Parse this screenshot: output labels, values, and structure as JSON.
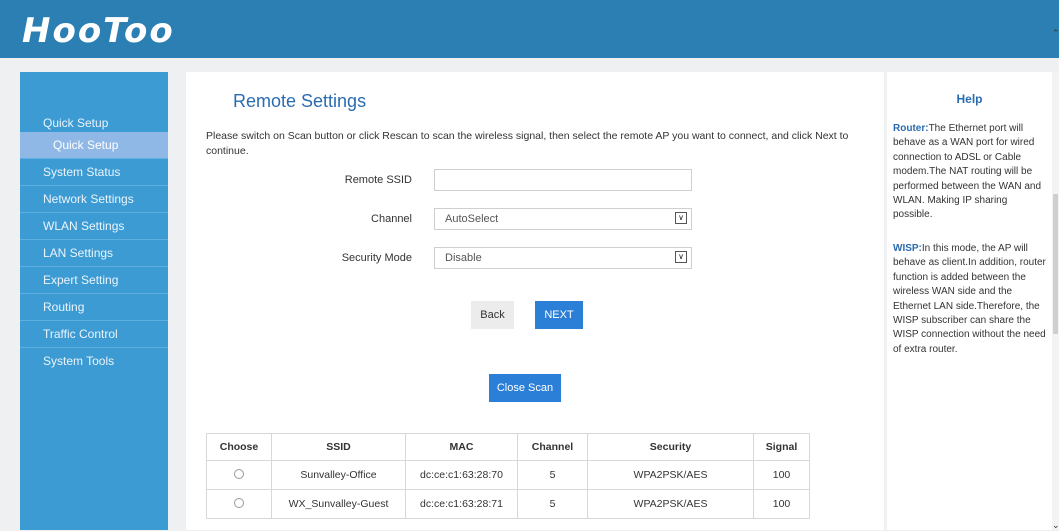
{
  "brand": {
    "logo_text": "HooToo"
  },
  "sidebar": {
    "items": [
      {
        "label": "Quick Setup"
      },
      {
        "label": "Quick Setup"
      },
      {
        "label": "System Status"
      },
      {
        "label": "Network Settings"
      },
      {
        "label": "WLAN Settings"
      },
      {
        "label": "LAN Settings"
      },
      {
        "label": "Expert Setting"
      },
      {
        "label": "Routing"
      },
      {
        "label": "Traffic Control"
      },
      {
        "label": "System Tools"
      }
    ]
  },
  "main": {
    "title": "Remote Settings",
    "description": "Please switch on Scan button or click Rescan to scan the wireless signal, then select the remote AP you want to connect, and click Next to continue.",
    "fields": {
      "ssid_label": "Remote SSID",
      "ssid_value": "",
      "channel_label": "Channel",
      "channel_value": "AutoSelect",
      "security_label": "Security Mode",
      "security_value": "Disable"
    },
    "buttons": {
      "back": "Back",
      "next": "NEXT",
      "close_scan": "Close Scan"
    },
    "table": {
      "headers": [
        "Choose",
        "SSID",
        "MAC",
        "Channel",
        "Security",
        "Signal"
      ],
      "rows": [
        {
          "ssid": "Sunvalley-Office",
          "mac": "dc:ce:c1:63:28:70",
          "channel": "5",
          "security": "WPA2PSK/AES",
          "signal": "100"
        },
        {
          "ssid": "WX_Sunvalley-Guest",
          "mac": "dc:ce:c1:63:28:71",
          "channel": "5",
          "security": "WPA2PSK/AES",
          "signal": "100"
        }
      ]
    }
  },
  "help": {
    "title": "Help",
    "router_term": "Router:",
    "router_text": "The Ethernet port will behave as a WAN port for wired connection to ADSL or Cable modem.The NAT routing will be performed between the WAN and WLAN. Making IP sharing possible.",
    "wisp_term": "WISP:",
    "wisp_text": "In this mode, the AP will behave as client.In addition, router function is added between the wireless WAN side and the Ethernet LAN side.Therefore, the WISP subscriber can share the WISP connection without the need of extra router."
  },
  "colors": {
    "header": "#2c7fb2",
    "sidebar": "#3d9bd4",
    "sidebar_active": "#8fb8e6",
    "accent_button": "#2c7fd6",
    "title": "#2a6cb0"
  },
  "icons": {
    "select_arrow": "chevron-down-icon",
    "radio": "radio-icon"
  }
}
